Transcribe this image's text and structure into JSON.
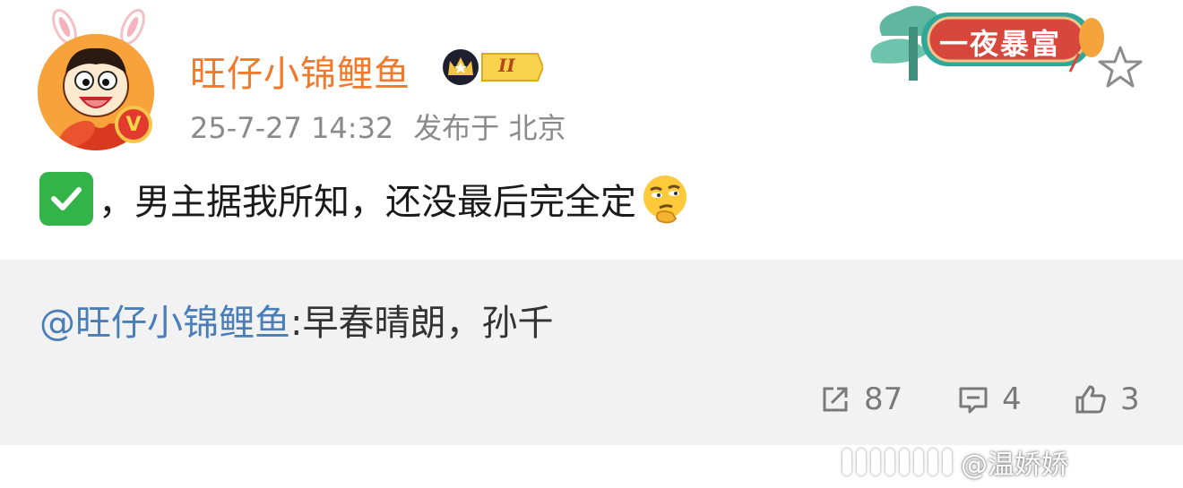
{
  "post": {
    "author": {
      "name": "旺仔小锦鲤鱼",
      "level_badge": "II",
      "verified_mark": "V"
    },
    "meta": {
      "time": "25-7-27 14:32",
      "location": "发布于 北京"
    },
    "festival_badge": "一夜暴富",
    "text": "，男主据我所知，还没最后完全定",
    "repost": {
      "mention": "@旺仔小锦鲤鱼",
      "content": ":早春晴朗，孙千"
    },
    "actions": {
      "share_count": "87",
      "comment_count": "4",
      "like_count": "3"
    }
  },
  "watermark": {
    "text": "@温娇娇"
  },
  "colors": {
    "username": "#f0792b",
    "mention": "#4a7eb8",
    "meta": "#8a8a8a",
    "repost_bg": "#f2f2f2",
    "check_green": "#32b449"
  },
  "icons": [
    "check-mark-emoji",
    "thinking-face-emoji",
    "star-outline-icon",
    "share-icon",
    "comment-icon",
    "like-icon",
    "crown-icon",
    "verified-v-icon"
  ]
}
